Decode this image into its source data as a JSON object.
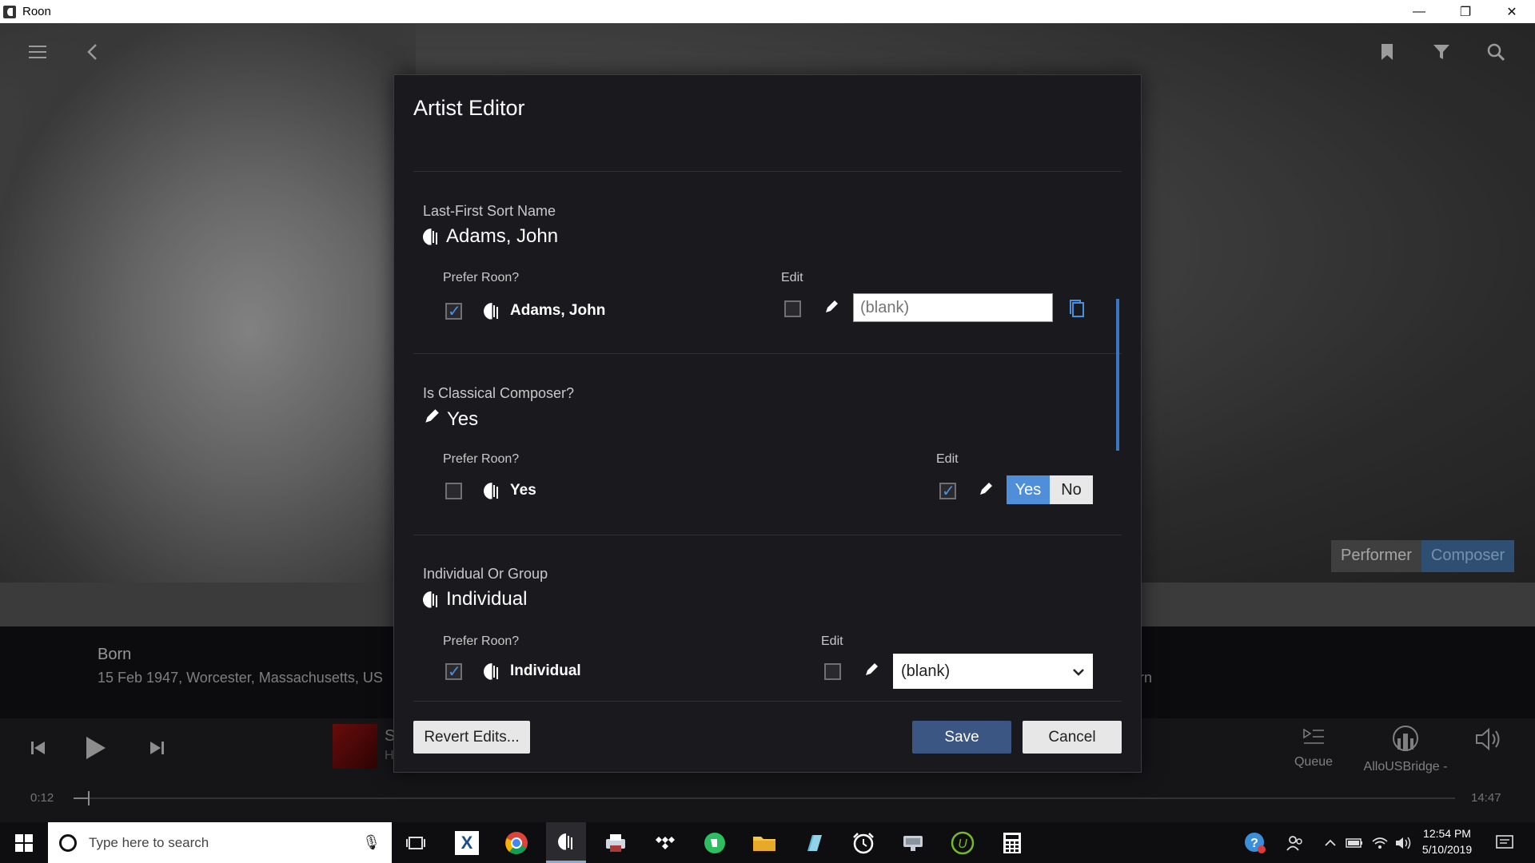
{
  "window": {
    "title": "Roon",
    "minimize": "—",
    "restore": "❐",
    "close": "✕"
  },
  "background": {
    "role_toggle": {
      "performer": "Performer",
      "composer": "Composer"
    },
    "born_label": "Born",
    "born_value": "15 Feb 1947, Worcester, Massachusetts, US",
    "right_fragment": "rn"
  },
  "player": {
    "track_fragment": "S",
    "track_fragment_2": "H",
    "queue_label": "Queue",
    "zone_label": "AlloUSBridge -",
    "elapsed": "0:12",
    "total": "14:47",
    "progress": 0.011
  },
  "dialog": {
    "title": "Artist Editor",
    "sort_name": {
      "label": "Last-First Sort Name",
      "value": "Adams, John",
      "prefer_label": "Prefer Roon?",
      "prefer_checked": true,
      "roon_value": "Adams, John",
      "edit_label": "Edit",
      "edit_checked": false,
      "input_placeholder": "(blank)"
    },
    "classical": {
      "label": "Is Classical Composer?",
      "value": "Yes",
      "prefer_label": "Prefer Roon?",
      "prefer_checked": false,
      "roon_value": "Yes",
      "edit_label": "Edit",
      "edit_checked": true,
      "yes_label": "Yes",
      "no_label": "No",
      "selected": "Yes"
    },
    "group": {
      "label": "Individual Or Group",
      "value": "Individual",
      "prefer_label": "Prefer Roon?",
      "prefer_checked": true,
      "roon_value": "Individual",
      "edit_label": "Edit",
      "edit_checked": false,
      "select_value": "(blank)"
    },
    "buttons": {
      "revert": "Revert Edits...",
      "save": "Save",
      "cancel": "Cancel"
    }
  },
  "taskbar": {
    "search_placeholder": "Type here to search",
    "clock_time": "12:54 PM",
    "clock_date": "5/10/2019"
  },
  "colors": {
    "accent": "#4f8fd9",
    "save_button": "#3b5683",
    "dialog_bg": "#1a1a1e"
  }
}
